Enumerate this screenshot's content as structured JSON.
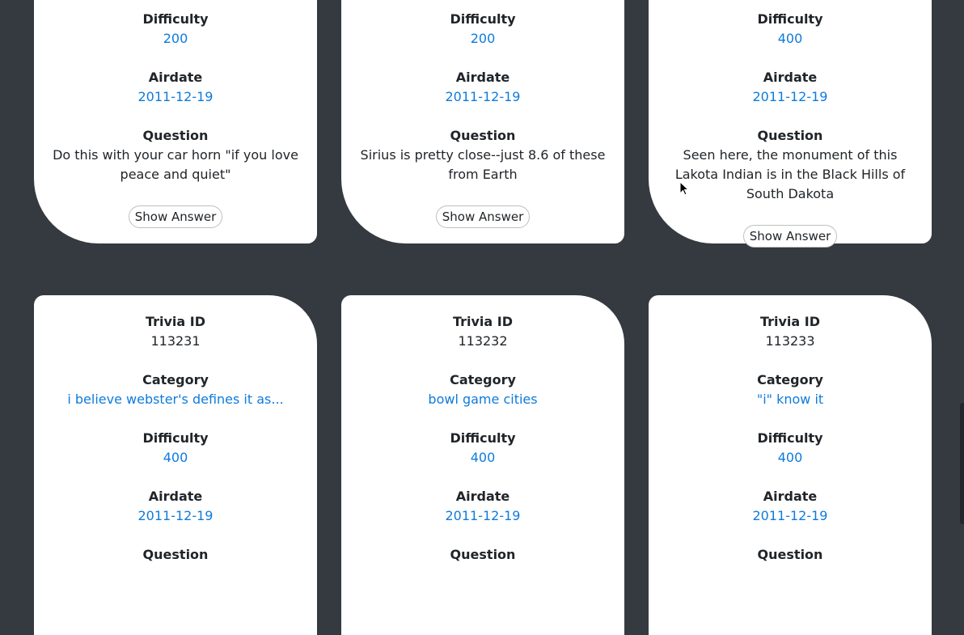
{
  "labels": {
    "trivia_id": "Trivia ID",
    "category": "Category",
    "difficulty": "Difficulty",
    "airdate": "Airdate",
    "question": "Question",
    "show_answer": "Show Answer"
  },
  "top_cards": [
    {
      "difficulty": "200",
      "airdate": "2011-12-19",
      "question": "Do this with your car horn \"if you love peace and quiet\""
    },
    {
      "difficulty": "200",
      "airdate": "2011-12-19",
      "question": "Sirius is pretty close--just 8.6 of these from Earth"
    },
    {
      "difficulty": "400",
      "airdate": "2011-12-19",
      "question": "Seen here, the monument of this Lakota Indian is in the Black Hills of South Dakota"
    }
  ],
  "bottom_cards": [
    {
      "trivia_id": "113231",
      "category": "i believe webster's defines it as...",
      "difficulty": "400",
      "airdate": "2011-12-19"
    },
    {
      "trivia_id": "113232",
      "category": "bowl game cities",
      "difficulty": "400",
      "airdate": "2011-12-19"
    },
    {
      "trivia_id": "113233",
      "category": "\"i\" know it",
      "difficulty": "400",
      "airdate": "2011-12-19"
    }
  ],
  "colors": {
    "background": "#343a40",
    "card": "#ffffff",
    "accent_link": "#0d7bdc",
    "text": "#212529"
  },
  "icons": {
    "cursor": "mouse-pointer-icon"
  }
}
